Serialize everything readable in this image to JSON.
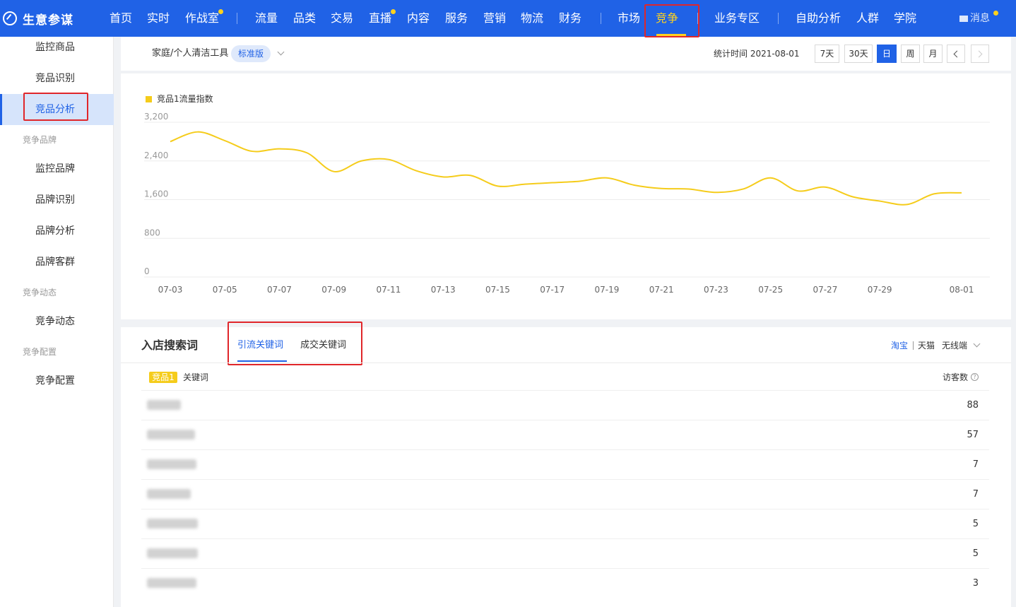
{
  "app": {
    "name": "生意参谋",
    "message_label": "消息"
  },
  "topnav": {
    "items": [
      {
        "label": "首页"
      },
      {
        "label": "实时"
      },
      {
        "label": "作战室"
      },
      {
        "label": "流量"
      },
      {
        "label": "品类"
      },
      {
        "label": "交易"
      },
      {
        "label": "直播"
      },
      {
        "label": "内容"
      },
      {
        "label": "服务"
      },
      {
        "label": "营销"
      },
      {
        "label": "物流"
      },
      {
        "label": "财务"
      },
      {
        "label": "市场"
      },
      {
        "label": "竞争"
      },
      {
        "label": "业务专区"
      },
      {
        "label": "自助分析"
      },
      {
        "label": "人群"
      },
      {
        "label": "学院"
      }
    ],
    "active": "竞争"
  },
  "sidebar": {
    "items": [
      {
        "label": "监控商品"
      },
      {
        "label": "竞品识别"
      },
      {
        "label": "竞品分析"
      },
      {
        "label": "竞争品牌"
      },
      {
        "label": "监控品牌"
      },
      {
        "label": "品牌识别"
      },
      {
        "label": "品牌分析"
      },
      {
        "label": "品牌客群"
      },
      {
        "label": "竞争动态"
      },
      {
        "label": "竞争动态"
      },
      {
        "label": "竞争配置"
      },
      {
        "label": "竞争配置"
      }
    ],
    "active": "竞品分析"
  },
  "filter": {
    "category": "家庭/个人清洁工具",
    "edition": "标准版",
    "stat_time_label": "统计时间 2021-08-01",
    "periods": [
      "7天",
      "30天",
      "日",
      "周",
      "月"
    ],
    "active_period": "日"
  },
  "chart_data": {
    "type": "line",
    "legend": "竞品1流量指数",
    "color": "#f5cc1b",
    "ylim": [
      0,
      3200
    ],
    "yticks": [
      "3,200",
      "2,400",
      "1,600",
      "800",
      "0"
    ],
    "xticks": [
      "07-03",
      "07-05",
      "07-07",
      "07-09",
      "07-11",
      "07-13",
      "07-15",
      "07-17",
      "07-19",
      "07-21",
      "07-23",
      "07-25",
      "07-27",
      "07-29",
      "08-01"
    ],
    "grid": true,
    "series": [
      {
        "name": "竞品1流量指数",
        "x": [
          "07-03",
          "07-04",
          "07-05",
          "07-06",
          "07-07",
          "07-08",
          "07-09",
          "07-10",
          "07-11",
          "07-12",
          "07-13",
          "07-14",
          "07-15",
          "07-16",
          "07-17",
          "07-18",
          "07-19",
          "07-20",
          "07-21",
          "07-22",
          "07-23",
          "07-24",
          "07-25",
          "07-26",
          "07-27",
          "07-28",
          "07-29",
          "07-30",
          "07-31",
          "08-01"
        ],
        "values": [
          2800,
          3000,
          2820,
          2600,
          2650,
          2570,
          2180,
          2400,
          2430,
          2200,
          2070,
          2100,
          1880,
          1920,
          1950,
          1980,
          2050,
          1900,
          1830,
          1820,
          1750,
          1820,
          2050,
          1780,
          1860,
          1660,
          1570,
          1500,
          1720,
          1740
        ]
      }
    ]
  },
  "keywords": {
    "title": "入店搜索词",
    "tabs": [
      "引流关键词",
      "成交关键词"
    ],
    "active_tab": "引流关键词",
    "platforms": [
      "淘宝",
      "天猫",
      "无线端"
    ],
    "active_platform": "淘宝",
    "competitor_badge": "竞品1",
    "col_keyword": "关键词",
    "col_visitors": "访客数",
    "rows": [
      {
        "visitors": "88"
      },
      {
        "visitors": "57"
      },
      {
        "visitors": "7"
      },
      {
        "visitors": "7"
      },
      {
        "visitors": "5"
      },
      {
        "visitors": "5"
      },
      {
        "visitors": "3"
      }
    ]
  }
}
